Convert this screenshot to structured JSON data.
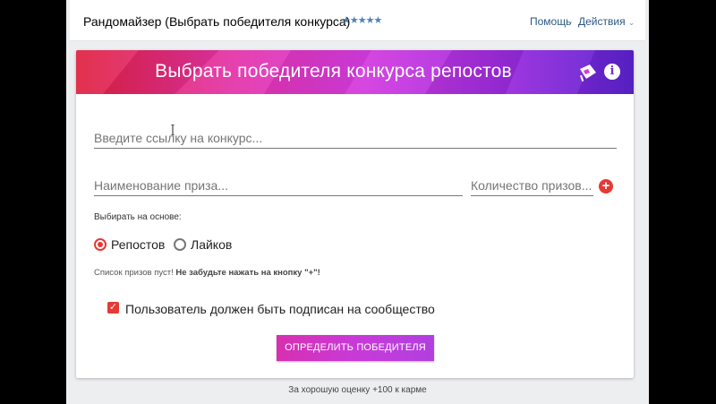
{
  "header": {
    "app_title": "Рандомайзер (Выбрать победителя конкурса)",
    "rating_stars": "★★★★★",
    "help_label": "Помощь",
    "separator": "·",
    "actions_label": "Действия"
  },
  "banner": {
    "title": "Выбрать победителя конкурса репостов"
  },
  "form": {
    "link_placeholder": "Введите ссылку на конкурс...",
    "prize_name_placeholder": "Наименование приза...",
    "prize_count_placeholder": "Количество призов...",
    "add_prize_label": "+",
    "basis_label": "Выбирать на основе:",
    "basis_options": [
      {
        "label": "Репостов",
        "selected": true
      },
      {
        "label": "Лайков",
        "selected": false
      }
    ],
    "empty_list_text": "Список призов пуст! ",
    "empty_list_hint": "Не забудьте нажать на кнопку \"+\"!",
    "subscribed_label": "Пользователь должен быть подписан на сообщество",
    "subscribed_checked": true,
    "submit_label": "ОПРЕДЕЛИТЬ ПОБЕДИТЕЛЯ"
  },
  "footer": {
    "note": "За хорошую оценку +100 к карме"
  },
  "colors": {
    "accent_red": "#e53935",
    "link_blue": "#2a5885",
    "banner_gradient_start": "#e0203e",
    "banner_gradient_end": "#5a23cf"
  }
}
